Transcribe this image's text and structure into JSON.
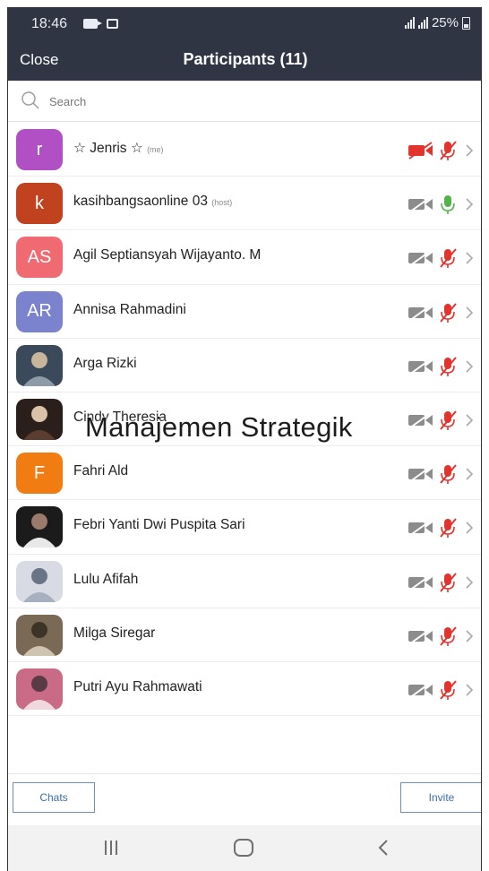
{
  "status_bar": {
    "time": "18:46",
    "battery": "25%"
  },
  "header": {
    "close_label": "Close",
    "title": "Participants (11)"
  },
  "search": {
    "placeholder": "Search"
  },
  "participants": [
    {
      "name": "☆ Jenris ☆",
      "tag": "(me)",
      "avatar_letter": "r",
      "avatar_color": "#b14fc5",
      "video": "off-red",
      "mic": "muted-red"
    },
    {
      "name": "kasihbangsaonline 03",
      "tag": "(host)",
      "avatar_letter": "k",
      "avatar_color": "#c0421f",
      "video": "off",
      "mic": "on-green"
    },
    {
      "name": "Agil Septiansyah Wijayanto. M",
      "tag": "",
      "avatar_letter": "AS",
      "avatar_color": "#f06b71",
      "video": "off",
      "mic": "muted"
    },
    {
      "name": "Annisa Rahmadini",
      "tag": "",
      "avatar_letter": "AR",
      "avatar_color": "#7b83cf",
      "video": "off",
      "mic": "muted"
    },
    {
      "name": "Arga Rizki",
      "tag": "",
      "avatar_letter": "",
      "avatar_color": "",
      "video": "off",
      "mic": "muted"
    },
    {
      "name": "Cindy Theresia",
      "tag": "",
      "avatar_letter": "",
      "avatar_color": "",
      "video": "off",
      "mic": "muted"
    },
    {
      "name": "Fahri Ald",
      "tag": "",
      "avatar_letter": "F",
      "avatar_color": "#f07c12",
      "video": "off",
      "mic": "muted"
    },
    {
      "name": "Febri Yanti Dwi Puspita Sari",
      "tag": "",
      "avatar_letter": "",
      "avatar_color": "",
      "video": "off",
      "mic": "muted"
    },
    {
      "name": "Lulu Afifah",
      "tag": "",
      "avatar_letter": "",
      "avatar_color": "",
      "video": "off",
      "mic": "muted"
    },
    {
      "name": "Milga Siregar",
      "tag": "",
      "avatar_letter": "",
      "avatar_color": "",
      "video": "off",
      "mic": "muted"
    },
    {
      "name": "Putri Ayu Rahmawati",
      "tag": "",
      "avatar_letter": "",
      "avatar_color": "",
      "video": "off",
      "mic": "muted"
    }
  ],
  "overlay": {
    "text": "Manajemen Strategik"
  },
  "footer": {
    "chats_label": "Chats",
    "invite_label": "Invite"
  },
  "colors": {
    "header_bg": "#2f3543",
    "muted_red": "#e2342d",
    "mic_green": "#54b24b",
    "icon_gray": "#8c8c8c"
  }
}
